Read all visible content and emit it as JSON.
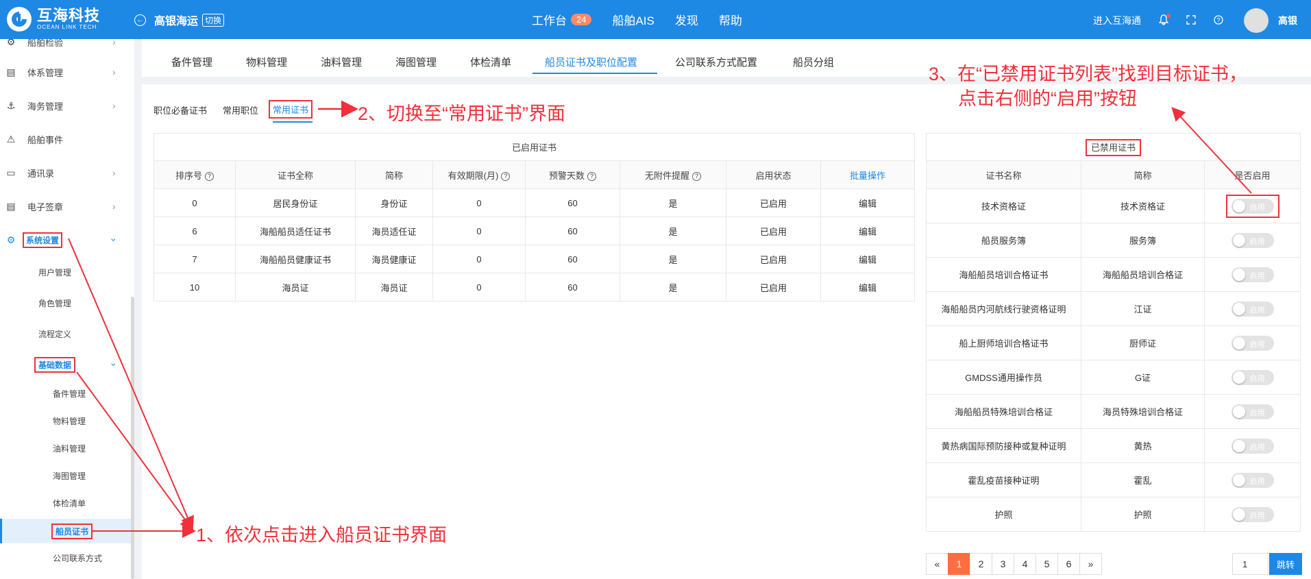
{
  "brand": {
    "name_cn": "互海科技",
    "name_en": "OCEAN LINK TECH"
  },
  "header": {
    "ship": "高银海运",
    "switch_label": "切换",
    "nav": [
      {
        "label": "工作台",
        "badge": "24"
      },
      {
        "label": "船舶AIS"
      },
      {
        "label": "发现"
      },
      {
        "label": "帮助"
      }
    ],
    "enter_label": "进入互海通",
    "user_name": "高银"
  },
  "sidebar": {
    "items": [
      {
        "label": "船舶检验"
      },
      {
        "label": "体系管理"
      },
      {
        "label": "海务管理"
      },
      {
        "label": "船舶事件"
      },
      {
        "label": "通讯录"
      },
      {
        "label": "电子签章"
      },
      {
        "label": "系统设置"
      }
    ],
    "sub": [
      {
        "label": "用户管理"
      },
      {
        "label": "角色管理"
      },
      {
        "label": "流程定义"
      },
      {
        "label": "基础数据"
      }
    ],
    "sub2": [
      {
        "label": "备件管理"
      },
      {
        "label": "物料管理"
      },
      {
        "label": "油料管理"
      },
      {
        "label": "海图管理"
      },
      {
        "label": "体检清单"
      },
      {
        "label": "船员证书"
      },
      {
        "label": "公司联系方式"
      }
    ]
  },
  "tabs": [
    "备件管理",
    "物料管理",
    "油料管理",
    "海图管理",
    "体检清单",
    "船员证书及职位配置",
    "公司联系方式配置",
    "船员分组"
  ],
  "subtabs": [
    "职位必备证书",
    "常用职位",
    "常用证书"
  ],
  "enabled_table": {
    "caption": "已启用证书",
    "headers": [
      "排序号",
      "证书全称",
      "简称",
      "有效期限(月)",
      "预警天数",
      "无附件提醒",
      "启用状态",
      "批量操作"
    ],
    "rows": [
      [
        "0",
        "居民身份证",
        "身份证",
        "0",
        "60",
        "是",
        "已启用",
        "编辑"
      ],
      [
        "6",
        "海船船员适任证书",
        "海员适任证",
        "0",
        "60",
        "是",
        "已启用",
        "编辑"
      ],
      [
        "7",
        "海船船员健康证书",
        "海员健康证",
        "0",
        "60",
        "是",
        "已启用",
        "编辑"
      ],
      [
        "10",
        "海员证",
        "海员证",
        "0",
        "60",
        "是",
        "已启用",
        "编辑"
      ]
    ]
  },
  "disabled_table": {
    "caption": "已禁用证书",
    "headers": [
      "证书名称",
      "简称",
      "是否启用"
    ],
    "toggle_label": "启用",
    "rows": [
      [
        "技术资格证",
        "技术资格证"
      ],
      [
        "船员服务簿",
        "服务簿"
      ],
      [
        "海船船员培训合格证书",
        "海船船员培训合格证"
      ],
      [
        "海船船员内河航线行驶资格证明",
        "江证"
      ],
      [
        "船上厨师培训合格证书",
        "厨师证"
      ],
      [
        "GMDSS通用操作员",
        "G证"
      ],
      [
        "海船船员特殊培训合格证",
        "海员特殊培训合格证"
      ],
      [
        "黄热病国际预防接种或复种证明",
        "黄热"
      ],
      [
        "霍乱疫苗接种证明",
        "霍乱"
      ],
      [
        "护照",
        "护照"
      ]
    ]
  },
  "pagination": {
    "prev": "«",
    "pages": [
      "1",
      "2",
      "3",
      "4",
      "5",
      "6"
    ],
    "next": "»",
    "active": "1",
    "jump_value": "1",
    "jump_label": "跳转"
  },
  "annotations": {
    "step1": "1、依次点击进入船员证书界面",
    "step2": "2、切换至“常用证书”界面",
    "step3_line1": "3、在“已禁用证书列表”找到目标证书，",
    "step3_line2": "点击右侧的“启用”按钮"
  },
  "colors": {
    "topbar": "#1e88e5",
    "accent": "#1e88e5",
    "annotation": "#f0303a",
    "page_active": "#ff6e40"
  }
}
